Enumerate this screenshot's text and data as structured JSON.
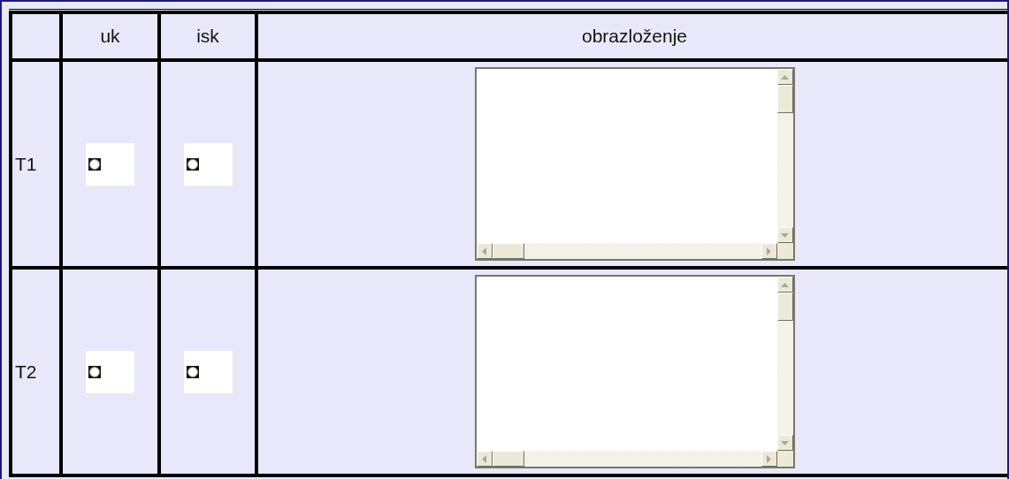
{
  "table": {
    "columns": [
      "uk",
      "isk",
      "obrazloženje"
    ],
    "rows": [
      {
        "label": "T1",
        "uk": {
          "selected": false
        },
        "isk": {
          "selected": false
        }
      },
      {
        "label": "T2",
        "uk": {
          "selected": false
        },
        "isk": {
          "selected": false
        }
      }
    ]
  }
}
